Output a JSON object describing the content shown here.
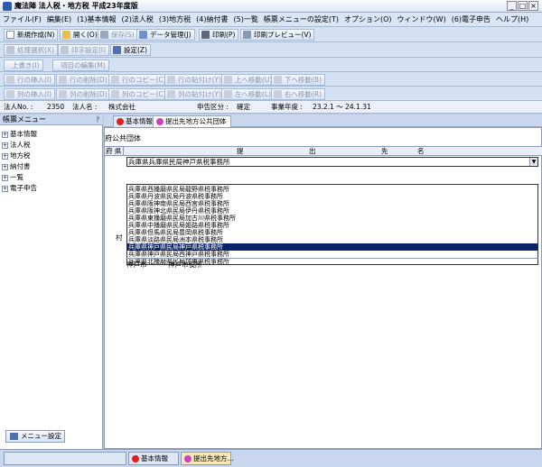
{
  "window": {
    "title": "魔法陣 法人税・地方税 平成23年度版",
    "buttons": [
      "_",
      "□",
      "×"
    ]
  },
  "menu": [
    "ファイル(F)",
    "編集(E)",
    "(1)基本情報",
    "(2)法人税",
    "(3)地方税",
    "(4)納付書",
    "(5)一覧",
    "帳票メニューの設定(T)",
    "オプション(O)",
    "ウィンドウ(W)",
    "(6)電子申告",
    "ヘルプ(H)"
  ],
  "toolbar1": [
    "新規作成(N)",
    "開く(O)",
    "保存(S)",
    "データ管理(J)",
    "印刷(P)",
    "印刷プレビュー(V)"
  ],
  "toolbar2": [
    "処理選択(X)",
    "印字設定(I)",
    "設定(Z)"
  ],
  "toolbar3": [
    "上書き(I)",
    "項目の編集(M)"
  ],
  "toolbar4": [
    "行の挿入(I)",
    "行の削除(D)",
    "行のコピー(C)",
    "行の貼付け(Y)",
    "上へ移動(U)",
    "下へ移動(B)"
  ],
  "toolbar5": [
    "列の挿入(I)",
    "列の削除(D)",
    "列のコピー(C)",
    "列の貼付け(Y)",
    "左へ移動(L)",
    "右へ移動(R)"
  ],
  "status": {
    "corp_no_label": "法人No. :",
    "corp_no": "2350",
    "corp_name_label": "法人名 :",
    "corp_name": "株式会社",
    "filing_label": "申告区分 :",
    "filing": "確定",
    "year_label": "事業年度 :",
    "year": "23.2.1 〜 24.1.31"
  },
  "left_panel": {
    "title": "帳票メニュー",
    "items": [
      "基本情報",
      "法人税",
      "地方税",
      "納付書",
      "一覧",
      "電子申告"
    ],
    "menu_button": "メニュー設定"
  },
  "tabs": [
    {
      "label": "基本情報",
      "color": "#e02020"
    },
    {
      "label": "提出先地方公共団体",
      "color": "#d040c0"
    }
  ],
  "content": {
    "heading": "府公共団体",
    "col1": "府 県",
    "col2": "提",
    "col3": "出",
    "col4": "先",
    "col5": "名",
    "combo_value": "兵庫県兵庫県民局神戸県税事務所",
    "options": [
      "兵庫県西播磨県民局龍野県税事務所",
      "兵庫県丹波県民局丹波県税事務所",
      "兵庫県阪神南県民局西宮県税事務所",
      "兵庫県阪神北県民局伊丹県税事務所",
      "兵庫県東播磨県民局加古川県税事務所",
      "兵庫県中播磨県民局姫路県税事務所",
      "兵庫県但馬県民局豊岡県税事務所",
      "兵庫県淡路県民局洲本県税事務所",
      "兵庫県神戸県民局神戸県税事務所",
      "兵庫県神戸県民局西神戸県税事務所",
      "兵庫県北播磨県民局加東県税事務所"
    ],
    "selected_index": 8,
    "row_label": "村",
    "row2_a": "神戸市",
    "row2_b": "神戸市役所"
  },
  "taskbar": [
    "基本情報",
    "提出先地方..."
  ]
}
